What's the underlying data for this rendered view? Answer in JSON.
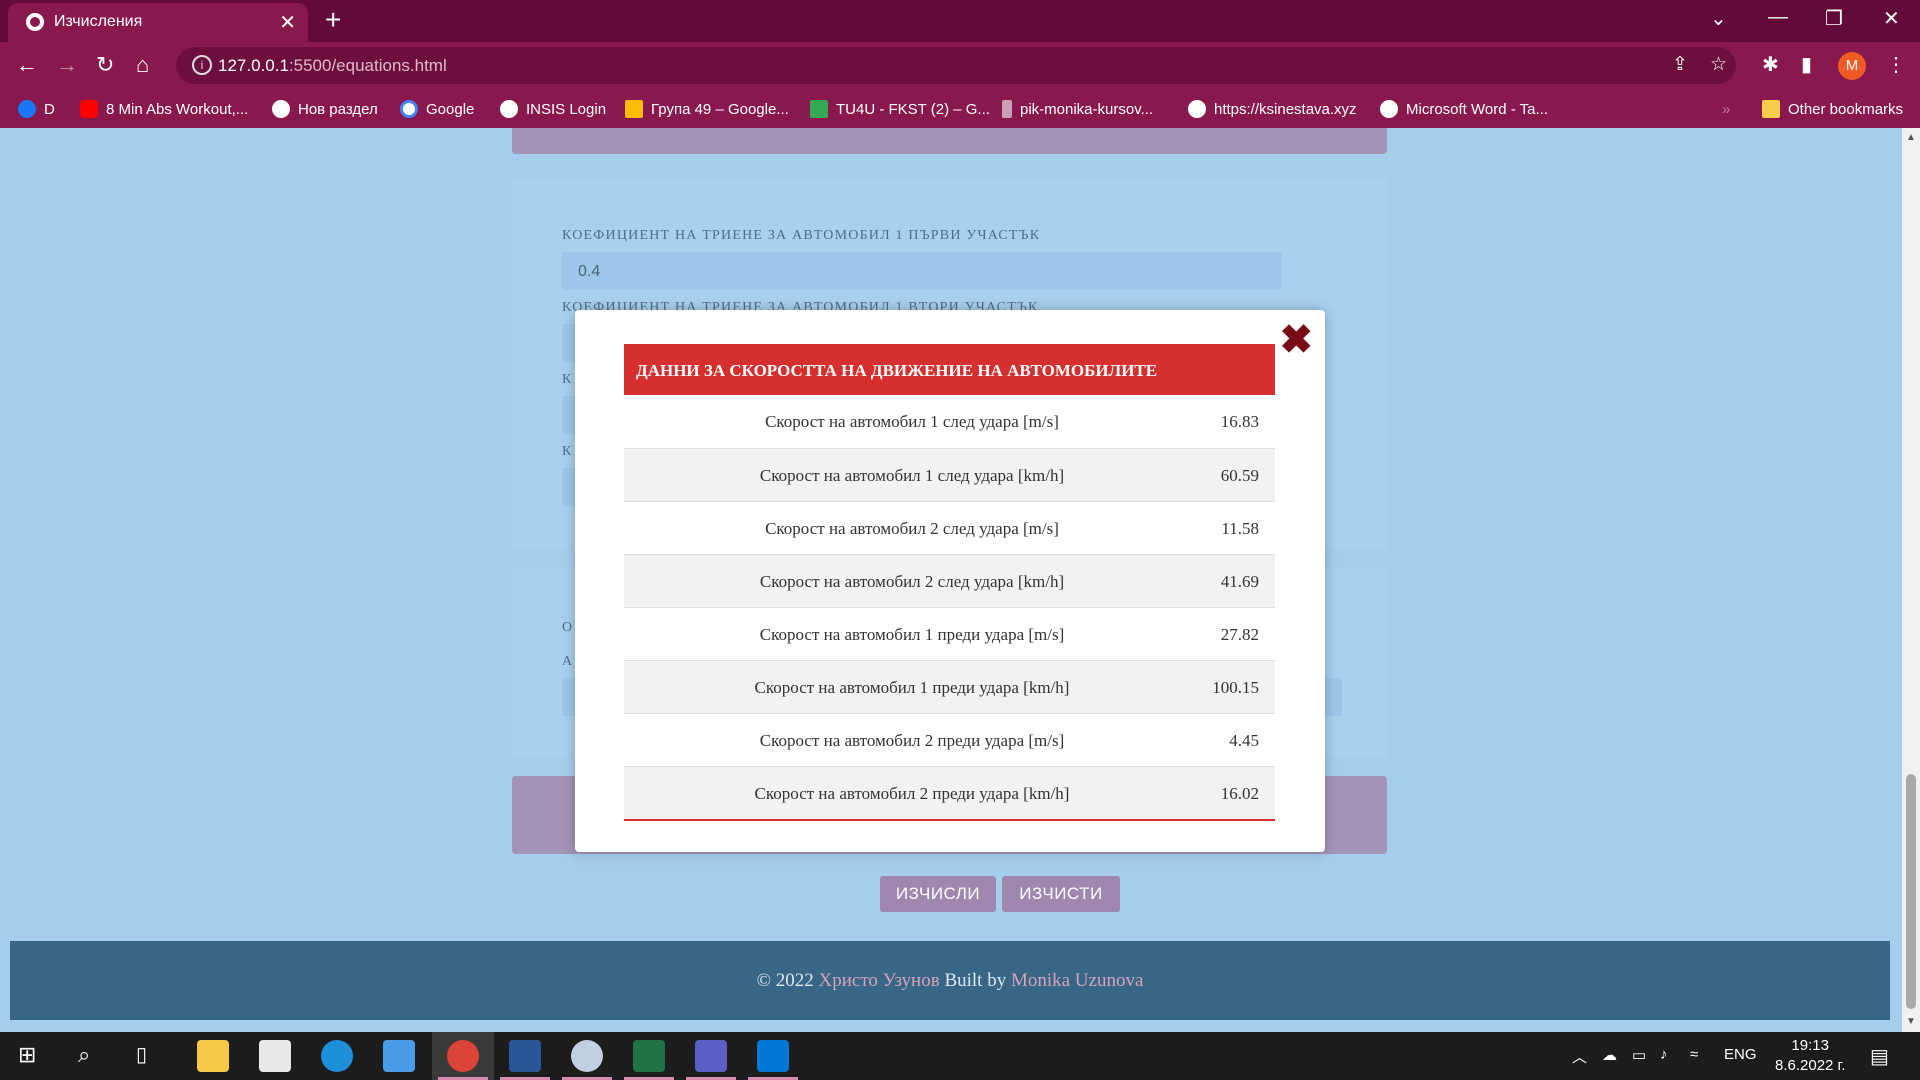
{
  "browser": {
    "tab_title": "Изчисления",
    "url_host": "127.0.0.1",
    "url_path": ":5500/equations.html",
    "profile_initial": "M",
    "bookmarks": [
      "D",
      "8 Min Abs Workout,...",
      "Нов раздел",
      "Google",
      "INSIS Login",
      "Група 49 – Google...",
      "TU4U - FKST (2) – G...",
      "pik-monika-kursov...",
      "https://ksinestava.xyz",
      "Microsoft Word - Ta..."
    ],
    "other_bookmarks": "Other bookmarks"
  },
  "form": {
    "friction_label_1": "КОЕФИЦИЕНТ НА ТРИЕНЕ ЗА АВТОМОБИЛ 1 ПЪРВИ УЧАСТЪК",
    "friction_value_1": "0.4",
    "friction_label_2": "КОЕФИЦИЕНТ НА ТРИЕНЕ ЗА АВТОМОБИЛ 1 ВТОРИ УЧАСТЪК",
    "label_fragment_3": "К",
    "label_fragment_4": "К",
    "label_fragment_5": "О",
    "label_fragment_6": "А"
  },
  "buttons": {
    "calculate": "ИЗЧИСЛИ",
    "clear": "ИЗЧИСТИ"
  },
  "footer": {
    "copyright": "© 2022",
    "author": "Христо Узунов",
    "built_by": "Built by",
    "builder": "Monika Uzunova"
  },
  "modal": {
    "close": "✖",
    "heading": "ДАННИ ЗА СКОРОСТТА НА ДВИЖЕНИЕ НА АВТОМОБИЛИТЕ",
    "rows": [
      {
        "label": "Скорост на автомобил 1 след удара [m/s]",
        "value": "16.83"
      },
      {
        "label": "Скорост на автомобил 1 след удара [km/h]",
        "value": "60.59"
      },
      {
        "label": "Скорост на автомобил 2 след удара [m/s]",
        "value": "11.58"
      },
      {
        "label": "Скорост на автомобил 2 след удара [km/h]",
        "value": "41.69"
      },
      {
        "label": "Скорост на автомобил 1 преди удара [m/s]",
        "value": "27.82"
      },
      {
        "label": "Скорост на автомобил 1 преди удара [km/h]",
        "value": "100.15"
      },
      {
        "label": "Скорост на автомобил 2 преди удара [m/s]",
        "value": "4.45"
      },
      {
        "label": "Скорост на автомобил 2 преди удара [km/h]",
        "value": "16.02"
      }
    ]
  },
  "taskbar": {
    "language": "ENG",
    "time": "19:13",
    "date": "8.6.2022 г."
  },
  "colors": {
    "browser_frame": "#88184e",
    "modal_header": "#d62f2f",
    "footer_bg": "#376686",
    "page_bg": "#a5cdec"
  }
}
